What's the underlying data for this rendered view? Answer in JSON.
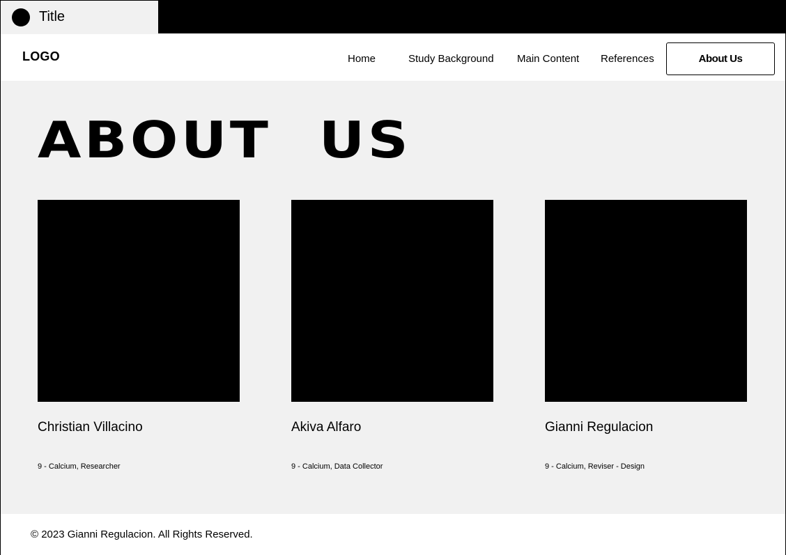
{
  "tab": {
    "title": "Title",
    "favicon": "circle-icon"
  },
  "header": {
    "logo": "LOGO",
    "nav": {
      "home": "Home",
      "study_background": "Study Background",
      "main_content": "Main Content",
      "references": "References",
      "about_us": "About Us"
    }
  },
  "main": {
    "title": "ABOUT US",
    "members": [
      {
        "name": "Christian Villacino",
        "role": "9 - Calcium,  Researcher"
      },
      {
        "name": "Akiva Alfaro",
        "role": "9 - Calcium,  Data Collector"
      },
      {
        "name": "Gianni Regulacion",
        "role": "9 - Calcium,  Reviser - Design"
      }
    ]
  },
  "footer": {
    "copyright": "© 2023 Gianni Regulacion. All Rights Reserved."
  },
  "colors": {
    "background": "#f1f1f1",
    "surface": "#ffffff",
    "ink": "#000000"
  }
}
